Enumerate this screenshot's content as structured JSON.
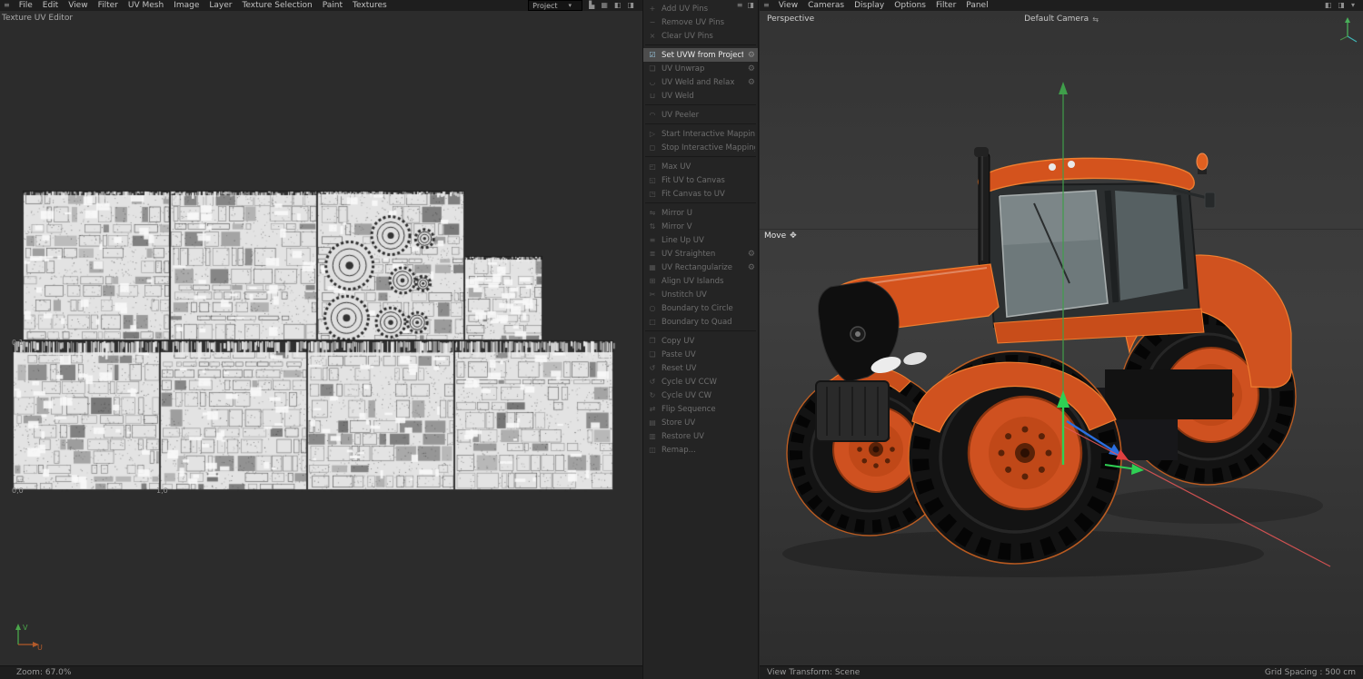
{
  "colors": {
    "accent_orange": "#d4531d",
    "selection_outline": "#ef7e30",
    "panel_bg": "#242424",
    "canvas_bg": "#2c2c2c",
    "viewport_bg": "#373737",
    "menubar_bg": "#1e1e1e",
    "uv_island": "#e3e3e3",
    "axis_green": "#3f9e4a",
    "axis_blue": "#2b6fe0",
    "axis_red": "#e05555"
  },
  "left": {
    "menu": [
      "File",
      "Edit",
      "View",
      "Filter",
      "UV Mesh",
      "Image",
      "Layer",
      "Texture Selection",
      "Paint",
      "Textures"
    ],
    "title": "Texture UV Editor",
    "project_label": "Project",
    "uv_labels": {
      "v1": "0,1",
      "origin": "0,0",
      "u1": "1,0"
    },
    "axis": {
      "v": "V",
      "u": "U"
    },
    "status_zoom": "Zoom: 67.0%"
  },
  "commands": {
    "items": [
      {
        "label": "Add UV Pins",
        "icon": "+",
        "state": "disabled"
      },
      {
        "label": "Remove UV Pins",
        "icon": "−",
        "state": "disabled"
      },
      {
        "label": "Clear UV Pins",
        "icon": "×",
        "state": "disabled",
        "sep": true
      },
      {
        "label": "Set UVW from Projection",
        "icon": "☑",
        "state": "active",
        "gear": true
      },
      {
        "label": "UV Unwrap",
        "icon": "❏",
        "state": "disabled",
        "gear": true
      },
      {
        "label": "UV Weld and Relax",
        "icon": "◡",
        "state": "disabled",
        "gear": true
      },
      {
        "label": "UV Weld",
        "icon": "⊔",
        "state": "disabled",
        "sep": true
      },
      {
        "label": "UV Peeler",
        "icon": "◠",
        "state": "disabled",
        "sep": true
      },
      {
        "label": "Start Interactive Mapping",
        "icon": "▷",
        "state": "disabled"
      },
      {
        "label": "Stop Interactive Mapping",
        "icon": "◻",
        "state": "disabled",
        "sep": true
      },
      {
        "label": "Max UV",
        "icon": "◰",
        "state": "disabled"
      },
      {
        "label": "Fit UV to Canvas",
        "icon": "◱",
        "state": "disabled"
      },
      {
        "label": "Fit Canvas to UV",
        "icon": "◳",
        "state": "disabled",
        "sep": true
      },
      {
        "label": "Mirror U",
        "icon": "⇋",
        "state": "disabled"
      },
      {
        "label": "Mirror V",
        "icon": "⇅",
        "state": "disabled"
      },
      {
        "label": "Line Up UV",
        "icon": "≡",
        "state": "disabled"
      },
      {
        "label": "UV Straighten",
        "icon": "≣",
        "state": "disabled",
        "gear": true
      },
      {
        "label": "UV Rectangularize",
        "icon": "▦",
        "state": "disabled",
        "gear": true
      },
      {
        "label": "Align UV Islands",
        "icon": "⊞",
        "state": "disabled"
      },
      {
        "label": "Unstitch UV",
        "icon": "✂",
        "state": "disabled"
      },
      {
        "label": "Boundary to Circle",
        "icon": "○",
        "state": "disabled"
      },
      {
        "label": "Boundary to Quad",
        "icon": "□",
        "state": "disabled",
        "sep": true
      },
      {
        "label": "Copy UV",
        "icon": "❐",
        "state": "disabled"
      },
      {
        "label": "Paste UV",
        "icon": "❏",
        "state": "disabled"
      },
      {
        "label": "Reset UV",
        "icon": "↺",
        "state": "disabled"
      },
      {
        "label": "Cycle UV CCW",
        "icon": "↺",
        "state": "disabled"
      },
      {
        "label": "Cycle UV CW",
        "icon": "↻",
        "state": "disabled"
      },
      {
        "label": "Flip Sequence",
        "icon": "⇄",
        "state": "disabled"
      },
      {
        "label": "Store UV",
        "icon": "▤",
        "state": "disabled"
      },
      {
        "label": "Restore UV",
        "icon": "▥",
        "state": "disabled"
      },
      {
        "label": "Remap...",
        "icon": "◫",
        "state": "disabled"
      }
    ]
  },
  "viewport": {
    "menu": [
      "View",
      "Cameras",
      "Display",
      "Options",
      "Filter",
      "Panel"
    ],
    "perspective_label": "Perspective",
    "camera_label": "Default Camera",
    "tool_label": "Move",
    "status_left": "View Transform: Scene",
    "status_right": "Grid Spacing : 500 cm"
  },
  "icons": {
    "hamburger": "≡",
    "chart": "▙",
    "grid": "▦",
    "dock_a": "◧",
    "dock_b": "◨",
    "caret_down": "▾",
    "gear": "⚙",
    "move": "✥",
    "camera_swap": "⇆"
  }
}
